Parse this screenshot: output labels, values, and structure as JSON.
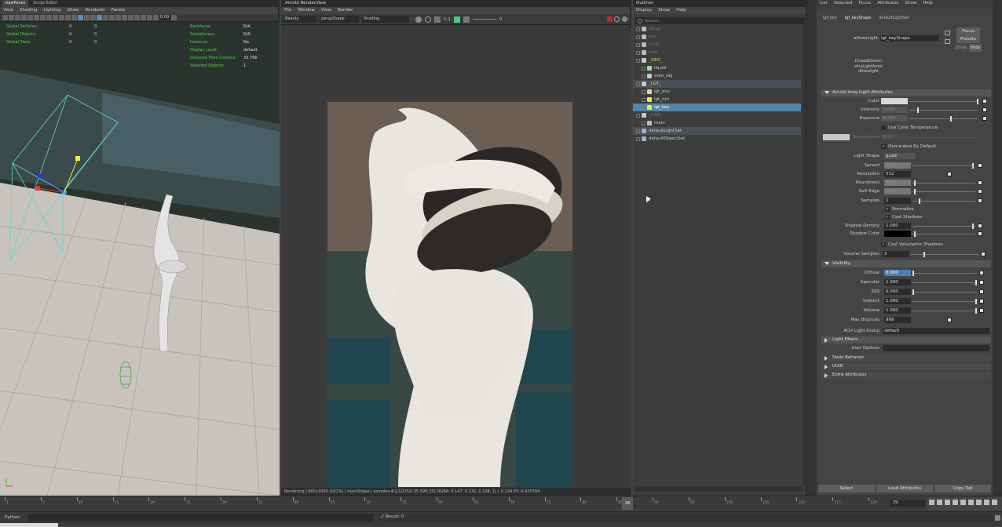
{
  "viewport": {
    "tabs": [
      "viewPanes",
      "Script Editor"
    ],
    "menu": [
      "View",
      "Shading",
      "Lighting",
      "Show",
      "Renderer",
      "Panels"
    ],
    "field_value": "0.00",
    "hud_left": [
      {
        "label": "Global Particles:",
        "a": "0",
        "b": "0"
      },
      {
        "label": "Global Objects:",
        "a": "0",
        "b": "0"
      },
      {
        "label": "Global Stats:",
        "a": "0",
        "b": "0"
      }
    ],
    "hud_right": [
      {
        "label": "Backfaces:",
        "value": "N/A"
      },
      {
        "label": "Smoothness:",
        "value": "N/A"
      },
      {
        "label": "Instance:",
        "value": "No"
      },
      {
        "label": "Display Layer:",
        "value": "default"
      },
      {
        "label": "Distance From Camera:",
        "value": "33.766"
      },
      {
        "label": "Selected Objects:",
        "value": "1"
      }
    ]
  },
  "renderview": {
    "title": "Arnold RenderView",
    "menu": [
      "File",
      "Window",
      "View",
      "Render"
    ],
    "aov": "Beauty",
    "camera": "perspShape",
    "mode": "Shading",
    "ratio": "1:1",
    "exposure": "0",
    "status": "Rendering | 600x1000 (101%) | mainShape | samples 4/1/1/1/5/2 35 599,331 RGBA: 0.147, 0.132, 0.108, 1) L 0.134 EV:-0.425764"
  },
  "outliner": {
    "title": "Outliner",
    "menu": [
      "Display",
      "Show",
      "Help"
    ],
    "search_placeholder": "Search...",
    "rows": [
      {
        "label": "persp",
        "indent": 0,
        "icon": "camera",
        "state": "dim"
      },
      {
        "label": "top",
        "indent": 0,
        "icon": "camera",
        "state": "dim"
      },
      {
        "label": "front",
        "indent": 0,
        "icon": "camera",
        "state": "dim"
      },
      {
        "label": "side",
        "indent": 0,
        "icon": "camera",
        "state": "dim"
      },
      {
        "label": "_GEO_",
        "indent": 0,
        "icon": "group",
        "state": "geo"
      },
      {
        "label": "liquid",
        "indent": 1,
        "icon": "curve",
        "state": "normal"
      },
      {
        "label": "oreo_obj",
        "indent": 1,
        "icon": "group",
        "state": "normal"
      },
      {
        "label": "_LGT_",
        "indent": 0,
        "icon": "group",
        "state": "lgt"
      },
      {
        "label": "lgt_env",
        "indent": 1,
        "icon": "globe",
        "state": "normal"
      },
      {
        "label": "lgt_rim",
        "indent": 1,
        "icon": "light",
        "state": "normal"
      },
      {
        "label": "lgt_key",
        "indent": 1,
        "icon": "light",
        "state": "selected"
      },
      {
        "label": "_CAM_",
        "indent": 0,
        "icon": "group",
        "state": "dim"
      },
      {
        "label": "main",
        "indent": 1,
        "icon": "camera",
        "state": "normal"
      },
      {
        "label": "defaultLightSet",
        "indent": 0,
        "icon": "set",
        "state": "highlight"
      },
      {
        "label": "defaultObjectSet",
        "indent": 0,
        "icon": "set",
        "state": "normal"
      }
    ]
  },
  "attribute_editor": {
    "menu": [
      "List",
      "Selected",
      "Focus",
      "Attributes",
      "Show",
      "Help"
    ],
    "tabs": [
      "lgt_key",
      "lgt_keyShape",
      "defaultLightSet"
    ],
    "node_label": "aiAreaLight:",
    "node_value": "lgt_keyShape",
    "focus": "Focus",
    "presets": "Presets",
    "show": "Show",
    "hide": "Hide",
    "drawdb": [
      "DrawdbGeometryLightArnoldArealight"
    ],
    "section_main": "Arnold Area Light Attributes",
    "rows": {
      "color": "Color",
      "intensity": "Intensity",
      "intensity_val": "1.000",
      "exposure": "Exposure",
      "exposure_val": "8.000",
      "use_color_temp": "Use Color Temperature",
      "temperature": "Temperature",
      "temperature_val": "6500",
      "illum_default": "Illuminates By Default",
      "light_shape": "Light Shape",
      "light_shape_val": "quad",
      "spread": "Spread",
      "spread_val": "1.000",
      "resolution": "Resolution",
      "resolution_val": "512",
      "roundness": "Roundness",
      "roundness_val": "0.000",
      "soft_edge": "Soft Edge",
      "soft_edge_val": "1.000",
      "samples": "Samples",
      "samples_val": "1",
      "normalize": "Normalize",
      "cast_shadows": "Cast Shadows",
      "shadow_density": "Shadow Density",
      "shadow_density_val": "1.000",
      "shadow_color": "Shadow Color",
      "cast_vol_shadows": "Cast Volumetric Shadows",
      "volume_samples": "Volume Samples",
      "volume_samples_val": "2"
    },
    "section_visibility": "Visibility",
    "visibility": [
      {
        "label": "Diffuse",
        "value": "0.000"
      },
      {
        "label": "Specular",
        "value": "1.000"
      },
      {
        "label": "SSS",
        "value": "0.000"
      },
      {
        "label": "Indirect",
        "value": "1.000"
      },
      {
        "label": "Volume",
        "value": "1.000"
      }
    ],
    "max_bounces": "Max Bounces",
    "max_bounces_val": "999",
    "aov_group": "AOV Light Group",
    "aov_group_val": "default",
    "section_light_filters": "Light Filters",
    "user_options": "User Options",
    "collapsed_sections": [
      "Node Behavior",
      "UUID",
      "Extra Attributes"
    ],
    "buttons": [
      "Select",
      "Load Attributes",
      "Copy Tab"
    ]
  },
  "timeline": {
    "ticks": [
      "1",
      "5",
      "10",
      "15",
      "20",
      "25",
      "30",
      "35",
      "40",
      "45",
      "50",
      "55",
      "60",
      "65",
      "70",
      "75",
      "80",
      "85",
      "90",
      "95",
      "100",
      "105",
      "110",
      "115",
      "120"
    ],
    "current_frame": "29",
    "frame_field": "29"
  },
  "command": {
    "lang": "Python",
    "result": "// Result: 0"
  },
  "colors": {
    "selection": "#5285a6",
    "hud_green": "#4fd04f",
    "panel": "#444444"
  }
}
